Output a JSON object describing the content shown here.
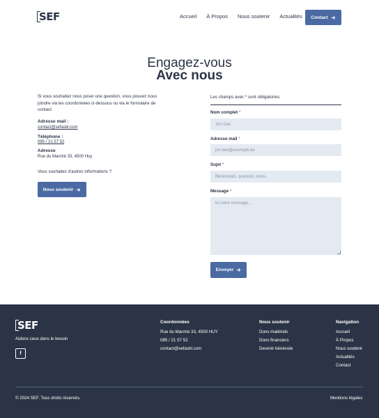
{
  "header": {
    "logo_text": "SEF",
    "nav": [
      "Accueil",
      "À Propos",
      "Nous soutenir",
      "Actualités"
    ],
    "contact_button": "Contact"
  },
  "hero": {
    "title_line1": "Engagez-vous",
    "title_line2": "Avec nous"
  },
  "info": {
    "intro": "Si vous souhaitez nous poser une question, vous pouvez nous joindre via les coordonnées ci-dessous ou via le formulaire de contact",
    "email_label": "Adresse mail :",
    "email_value": "contact@sefasbl.com",
    "phone_label": "Téléphone :",
    "phone_value": "085 / 21 57 52",
    "address_label": "Adresse",
    "address_value": "Rue du Marché 33, 4500 Huy",
    "more_info": "Vous souhaitez d'autres informations ?",
    "support_button": "Nous soutenir"
  },
  "form": {
    "required_note": "Les champs avec * sont obligatoires.",
    "name_label": "Nom complet",
    "name_placeholder": "Jon Doe",
    "email_label": "Adresse mail",
    "email_placeholder": "jon.doe@exemple.be",
    "subject_label": "Sujet",
    "subject_placeholder": "Bénévolats, question, dons...",
    "message_label": "Message",
    "message_placeholder": "Ici votre message...",
    "required_mark": "*",
    "submit_button": "Envoyer"
  },
  "footer": {
    "logo_text": "SEF",
    "tagline": "Aidons ceux dans le besoin",
    "facebook_glyph": "f",
    "coordinates_title": "Coordonnées",
    "coordinates": [
      "Rue du Marché 33, 4500 HUY",
      "085 / 21 57 52",
      "contact@sefasbl.com"
    ],
    "support_title": "Nous soutenir",
    "support_links": [
      "Dons matériels",
      "Dons financiers",
      "Devenir bénévole"
    ],
    "nav_title": "Navigation",
    "nav_links": [
      "Accueil",
      "À Propos",
      "Nous soutenir",
      "Actualités",
      "Contact"
    ],
    "copyright": "© 2024 SEF. Tous droits réservés.",
    "legal": "Mentions légales"
  },
  "colors": {
    "primary": "#4b6aa3",
    "dark": "#2b3446",
    "input_bg": "#e4eaf2",
    "required": "#c0392b"
  },
  "icons": {
    "arrow": "arrow-right-icon",
    "facebook": "facebook-icon"
  }
}
